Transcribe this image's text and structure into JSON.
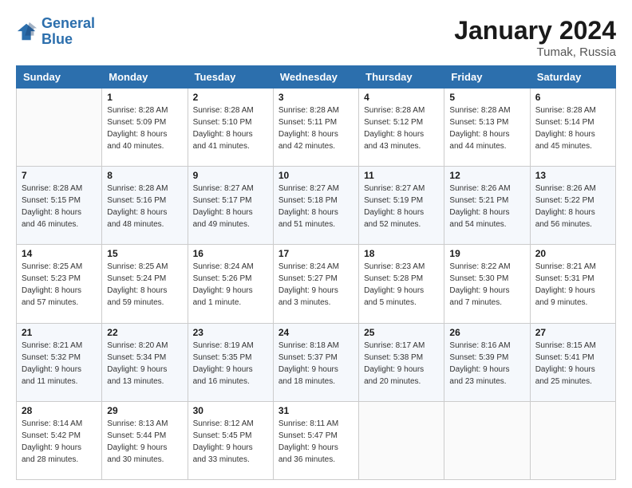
{
  "logo": {
    "line1": "General",
    "line2": "Blue"
  },
  "title": "January 2024",
  "subtitle": "Tumak, Russia",
  "header_days": [
    "Sunday",
    "Monday",
    "Tuesday",
    "Wednesday",
    "Thursday",
    "Friday",
    "Saturday"
  ],
  "weeks": [
    [
      {
        "day": "",
        "sunrise": "",
        "sunset": "",
        "daylight": ""
      },
      {
        "day": "1",
        "sunrise": "Sunrise: 8:28 AM",
        "sunset": "Sunset: 5:09 PM",
        "daylight": "Daylight: 8 hours and 40 minutes."
      },
      {
        "day": "2",
        "sunrise": "Sunrise: 8:28 AM",
        "sunset": "Sunset: 5:10 PM",
        "daylight": "Daylight: 8 hours and 41 minutes."
      },
      {
        "day": "3",
        "sunrise": "Sunrise: 8:28 AM",
        "sunset": "Sunset: 5:11 PM",
        "daylight": "Daylight: 8 hours and 42 minutes."
      },
      {
        "day": "4",
        "sunrise": "Sunrise: 8:28 AM",
        "sunset": "Sunset: 5:12 PM",
        "daylight": "Daylight: 8 hours and 43 minutes."
      },
      {
        "day": "5",
        "sunrise": "Sunrise: 8:28 AM",
        "sunset": "Sunset: 5:13 PM",
        "daylight": "Daylight: 8 hours and 44 minutes."
      },
      {
        "day": "6",
        "sunrise": "Sunrise: 8:28 AM",
        "sunset": "Sunset: 5:14 PM",
        "daylight": "Daylight: 8 hours and 45 minutes."
      }
    ],
    [
      {
        "day": "7",
        "sunrise": "Sunrise: 8:28 AM",
        "sunset": "Sunset: 5:15 PM",
        "daylight": "Daylight: 8 hours and 46 minutes."
      },
      {
        "day": "8",
        "sunrise": "Sunrise: 8:28 AM",
        "sunset": "Sunset: 5:16 PM",
        "daylight": "Daylight: 8 hours and 48 minutes."
      },
      {
        "day": "9",
        "sunrise": "Sunrise: 8:27 AM",
        "sunset": "Sunset: 5:17 PM",
        "daylight": "Daylight: 8 hours and 49 minutes."
      },
      {
        "day": "10",
        "sunrise": "Sunrise: 8:27 AM",
        "sunset": "Sunset: 5:18 PM",
        "daylight": "Daylight: 8 hours and 51 minutes."
      },
      {
        "day": "11",
        "sunrise": "Sunrise: 8:27 AM",
        "sunset": "Sunset: 5:19 PM",
        "daylight": "Daylight: 8 hours and 52 minutes."
      },
      {
        "day": "12",
        "sunrise": "Sunrise: 8:26 AM",
        "sunset": "Sunset: 5:21 PM",
        "daylight": "Daylight: 8 hours and 54 minutes."
      },
      {
        "day": "13",
        "sunrise": "Sunrise: 8:26 AM",
        "sunset": "Sunset: 5:22 PM",
        "daylight": "Daylight: 8 hours and 56 minutes."
      }
    ],
    [
      {
        "day": "14",
        "sunrise": "Sunrise: 8:25 AM",
        "sunset": "Sunset: 5:23 PM",
        "daylight": "Daylight: 8 hours and 57 minutes."
      },
      {
        "day": "15",
        "sunrise": "Sunrise: 8:25 AM",
        "sunset": "Sunset: 5:24 PM",
        "daylight": "Daylight: 8 hours and 59 minutes."
      },
      {
        "day": "16",
        "sunrise": "Sunrise: 8:24 AM",
        "sunset": "Sunset: 5:26 PM",
        "daylight": "Daylight: 9 hours and 1 minute."
      },
      {
        "day": "17",
        "sunrise": "Sunrise: 8:24 AM",
        "sunset": "Sunset: 5:27 PM",
        "daylight": "Daylight: 9 hours and 3 minutes."
      },
      {
        "day": "18",
        "sunrise": "Sunrise: 8:23 AM",
        "sunset": "Sunset: 5:28 PM",
        "daylight": "Daylight: 9 hours and 5 minutes."
      },
      {
        "day": "19",
        "sunrise": "Sunrise: 8:22 AM",
        "sunset": "Sunset: 5:30 PM",
        "daylight": "Daylight: 9 hours and 7 minutes."
      },
      {
        "day": "20",
        "sunrise": "Sunrise: 8:21 AM",
        "sunset": "Sunset: 5:31 PM",
        "daylight": "Daylight: 9 hours and 9 minutes."
      }
    ],
    [
      {
        "day": "21",
        "sunrise": "Sunrise: 8:21 AM",
        "sunset": "Sunset: 5:32 PM",
        "daylight": "Daylight: 9 hours and 11 minutes."
      },
      {
        "day": "22",
        "sunrise": "Sunrise: 8:20 AM",
        "sunset": "Sunset: 5:34 PM",
        "daylight": "Daylight: 9 hours and 13 minutes."
      },
      {
        "day": "23",
        "sunrise": "Sunrise: 8:19 AM",
        "sunset": "Sunset: 5:35 PM",
        "daylight": "Daylight: 9 hours and 16 minutes."
      },
      {
        "day": "24",
        "sunrise": "Sunrise: 8:18 AM",
        "sunset": "Sunset: 5:37 PM",
        "daylight": "Daylight: 9 hours and 18 minutes."
      },
      {
        "day": "25",
        "sunrise": "Sunrise: 8:17 AM",
        "sunset": "Sunset: 5:38 PM",
        "daylight": "Daylight: 9 hours and 20 minutes."
      },
      {
        "day": "26",
        "sunrise": "Sunrise: 8:16 AM",
        "sunset": "Sunset: 5:39 PM",
        "daylight": "Daylight: 9 hours and 23 minutes."
      },
      {
        "day": "27",
        "sunrise": "Sunrise: 8:15 AM",
        "sunset": "Sunset: 5:41 PM",
        "daylight": "Daylight: 9 hours and 25 minutes."
      }
    ],
    [
      {
        "day": "28",
        "sunrise": "Sunrise: 8:14 AM",
        "sunset": "Sunset: 5:42 PM",
        "daylight": "Daylight: 9 hours and 28 minutes."
      },
      {
        "day": "29",
        "sunrise": "Sunrise: 8:13 AM",
        "sunset": "Sunset: 5:44 PM",
        "daylight": "Daylight: 9 hours and 30 minutes."
      },
      {
        "day": "30",
        "sunrise": "Sunrise: 8:12 AM",
        "sunset": "Sunset: 5:45 PM",
        "daylight": "Daylight: 9 hours and 33 minutes."
      },
      {
        "day": "31",
        "sunrise": "Sunrise: 8:11 AM",
        "sunset": "Sunset: 5:47 PM",
        "daylight": "Daylight: 9 hours and 36 minutes."
      },
      {
        "day": "",
        "sunrise": "",
        "sunset": "",
        "daylight": ""
      },
      {
        "day": "",
        "sunrise": "",
        "sunset": "",
        "daylight": ""
      },
      {
        "day": "",
        "sunrise": "",
        "sunset": "",
        "daylight": ""
      }
    ]
  ]
}
